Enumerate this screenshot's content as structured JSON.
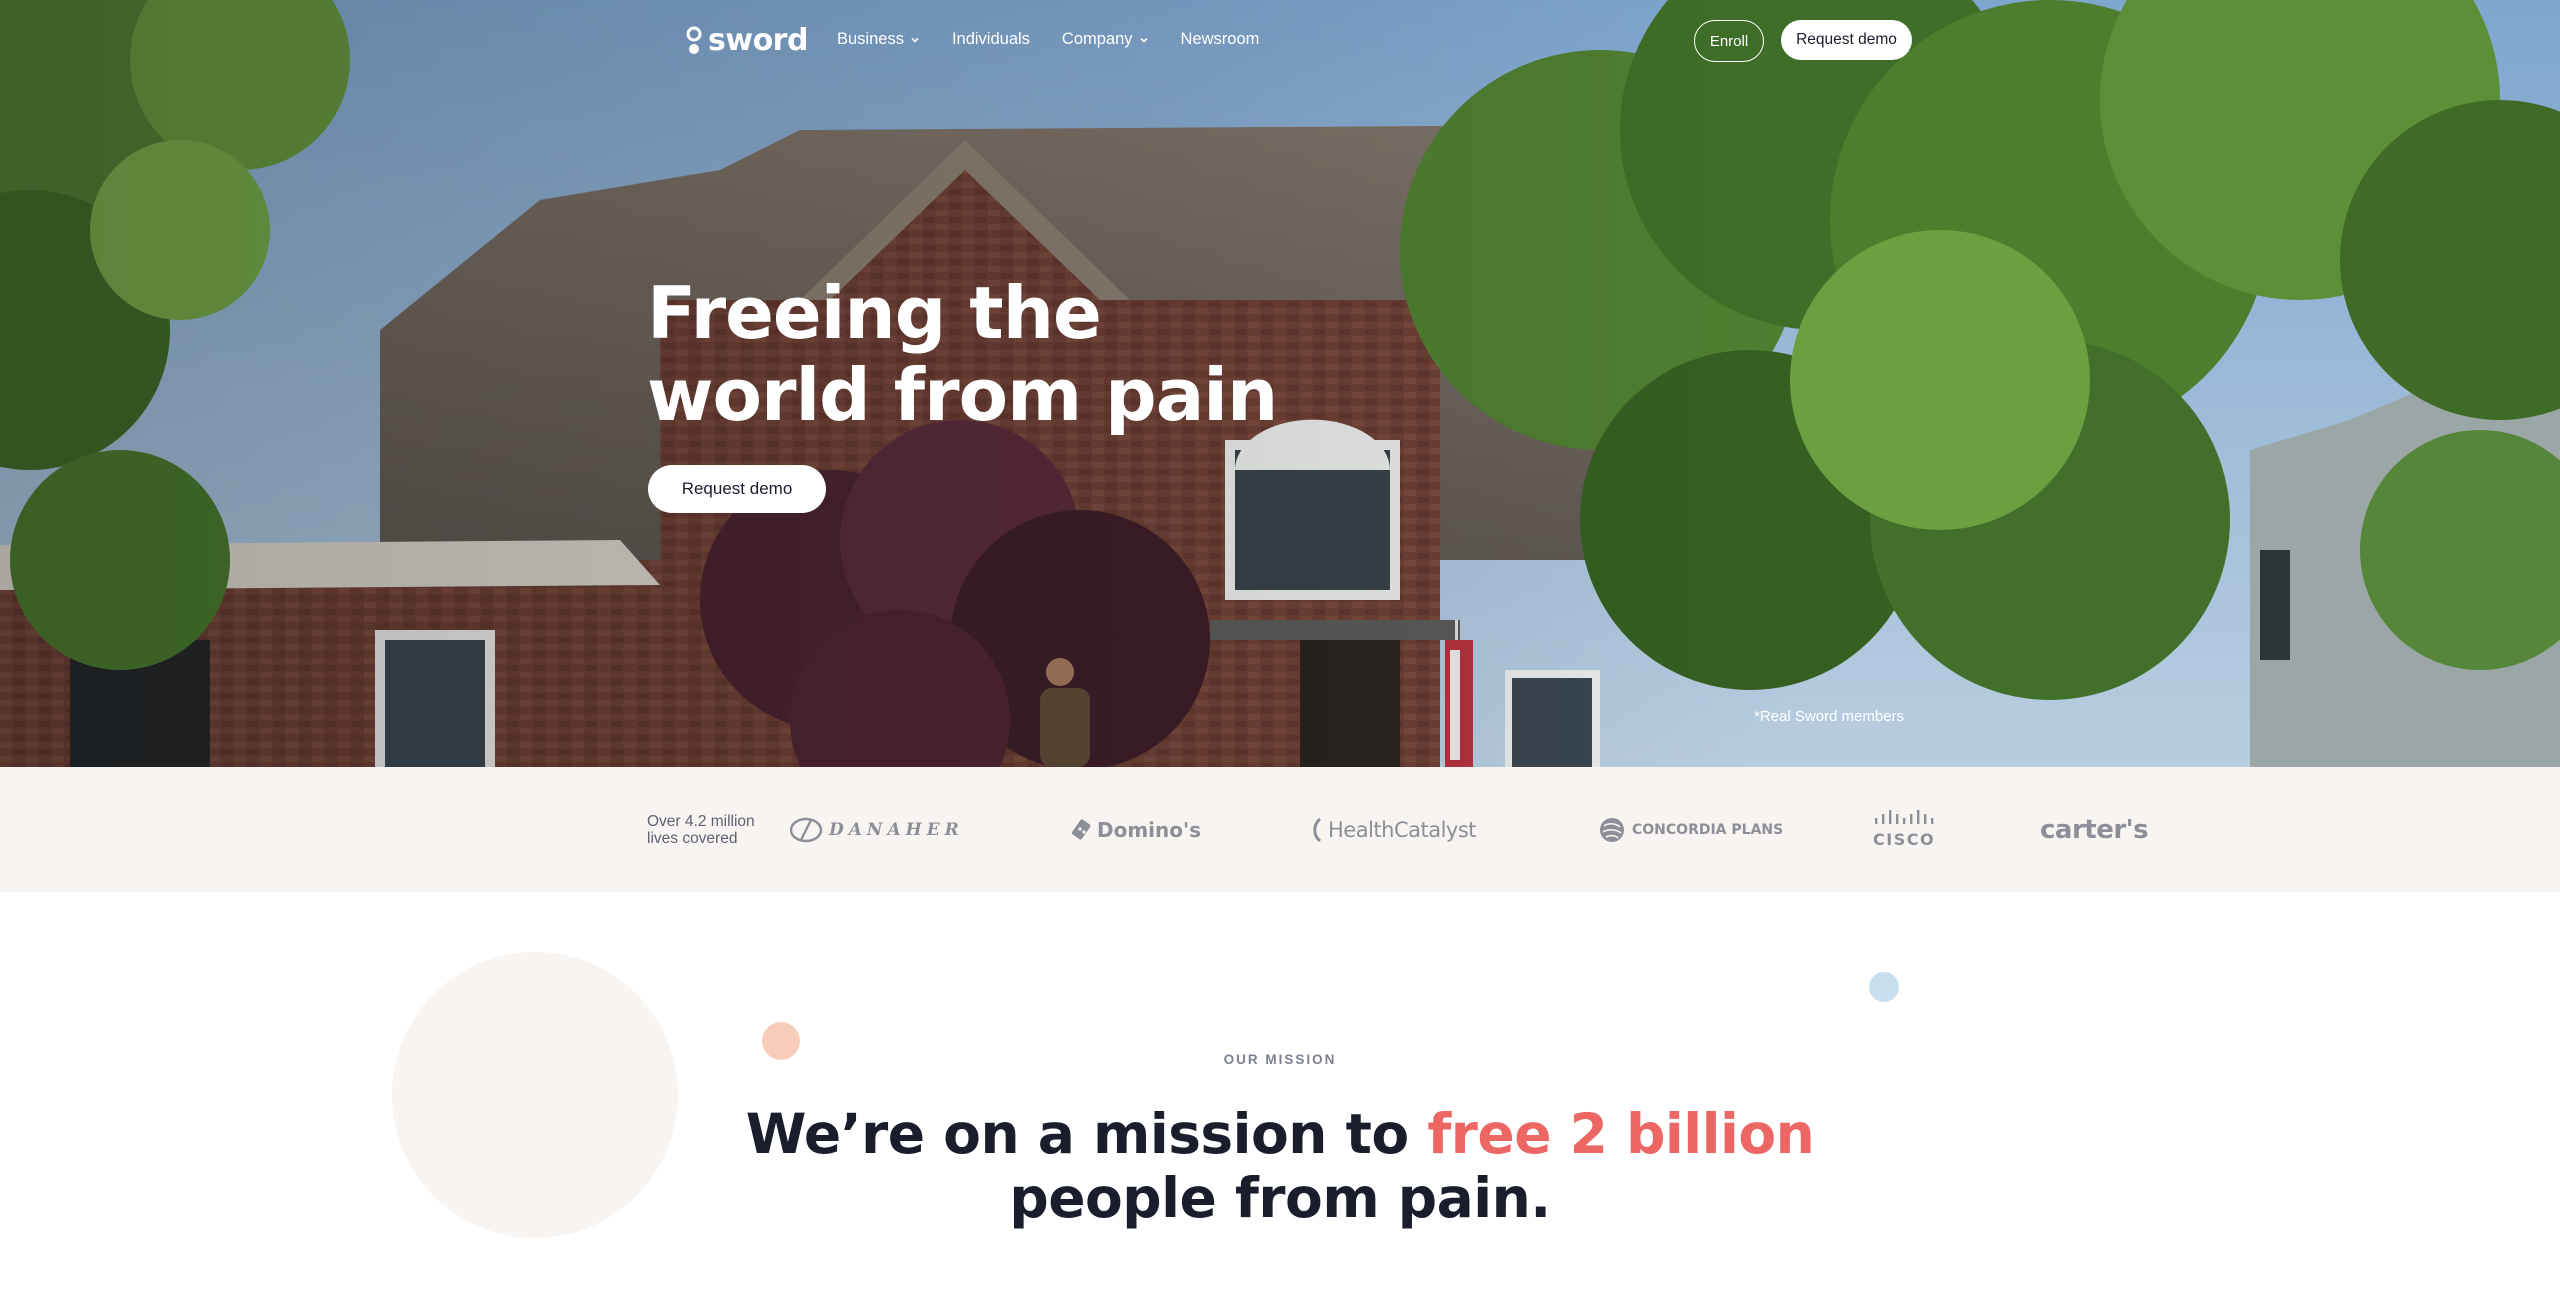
{
  "colors": {
    "accent_red": "#ec6664",
    "dark_text": "#1a1d2b",
    "strip_bg": "#f7f4f1",
    "logo_gray": "#8d8f98",
    "peach_dot": "#f7cdb9",
    "blue_dot": "#c7dfec"
  },
  "nav": {
    "logo_text": "sword",
    "links": [
      {
        "label": "Business",
        "icon": "chevron-down-icon"
      },
      {
        "label": "Individuals"
      },
      {
        "label": "Company",
        "icon": "chevron-down-icon"
      },
      {
        "label": "Newsroom"
      }
    ],
    "enroll_label": "Enroll",
    "request_demo_label": "Request demo"
  },
  "hero": {
    "title_line1": "Freeing the",
    "title_line2": "world from pain",
    "cta_label": "Request demo",
    "footnote": "*Real Sword members"
  },
  "logo_strip": {
    "lives_line1": "Over 4.2 million",
    "lives_line2": "lives covered",
    "clients": [
      "DANAHER",
      "Domino's",
      "HealthCatalyst",
      "CONCORDIA PLANS",
      "CISCO",
      "carter's"
    ]
  },
  "mission": {
    "eyebrow": "OUR MISSION",
    "title_part1": "We’re on a mission to ",
    "title_highlight": "free 2 billion",
    "title_line2": "people from pain."
  }
}
